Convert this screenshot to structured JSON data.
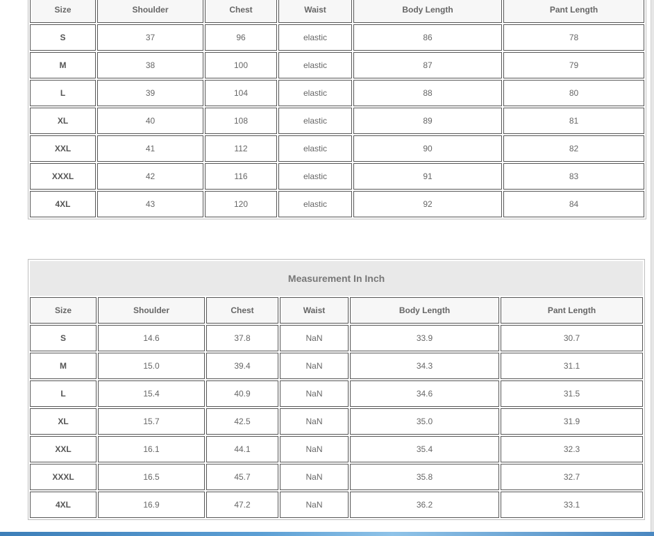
{
  "cm_table": {
    "headers": [
      "Size",
      "Shoulder",
      "Chest",
      "Waist",
      "Body Length",
      "Pant Length"
    ],
    "rows": [
      [
        "S",
        "37",
        "96",
        "elastic",
        "86",
        "78"
      ],
      [
        "M",
        "38",
        "100",
        "elastic",
        "87",
        "79"
      ],
      [
        "L",
        "39",
        "104",
        "elastic",
        "88",
        "80"
      ],
      [
        "XL",
        "40",
        "108",
        "elastic",
        "89",
        "81"
      ],
      [
        "XXL",
        "41",
        "112",
        "elastic",
        "90",
        "82"
      ],
      [
        "XXXL",
        "42",
        "116",
        "elastic",
        "91",
        "83"
      ],
      [
        "4XL",
        "43",
        "120",
        "elastic",
        "92",
        "84"
      ]
    ]
  },
  "inch_table": {
    "caption": "Measurement In Inch",
    "headers": [
      "Size",
      "Shoulder",
      "Chest",
      "Waist",
      "Body Length",
      "Pant Length"
    ],
    "rows": [
      [
        "S",
        "14.6",
        "37.8",
        "NaN",
        "33.9",
        "30.7"
      ],
      [
        "M",
        "15.0",
        "39.4",
        "NaN",
        "34.3",
        "31.1"
      ],
      [
        "L",
        "15.4",
        "40.9",
        "NaN",
        "34.6",
        "31.5"
      ],
      [
        "XL",
        "15.7",
        "42.5",
        "NaN",
        "35.0",
        "31.9"
      ],
      [
        "XXL",
        "16.1",
        "44.1",
        "NaN",
        "35.4",
        "32.3"
      ],
      [
        "XXXL",
        "16.5",
        "45.7",
        "NaN",
        "35.8",
        "32.7"
      ],
      [
        "4XL",
        "16.9",
        "47.2",
        "NaN",
        "36.2",
        "33.1"
      ]
    ]
  }
}
